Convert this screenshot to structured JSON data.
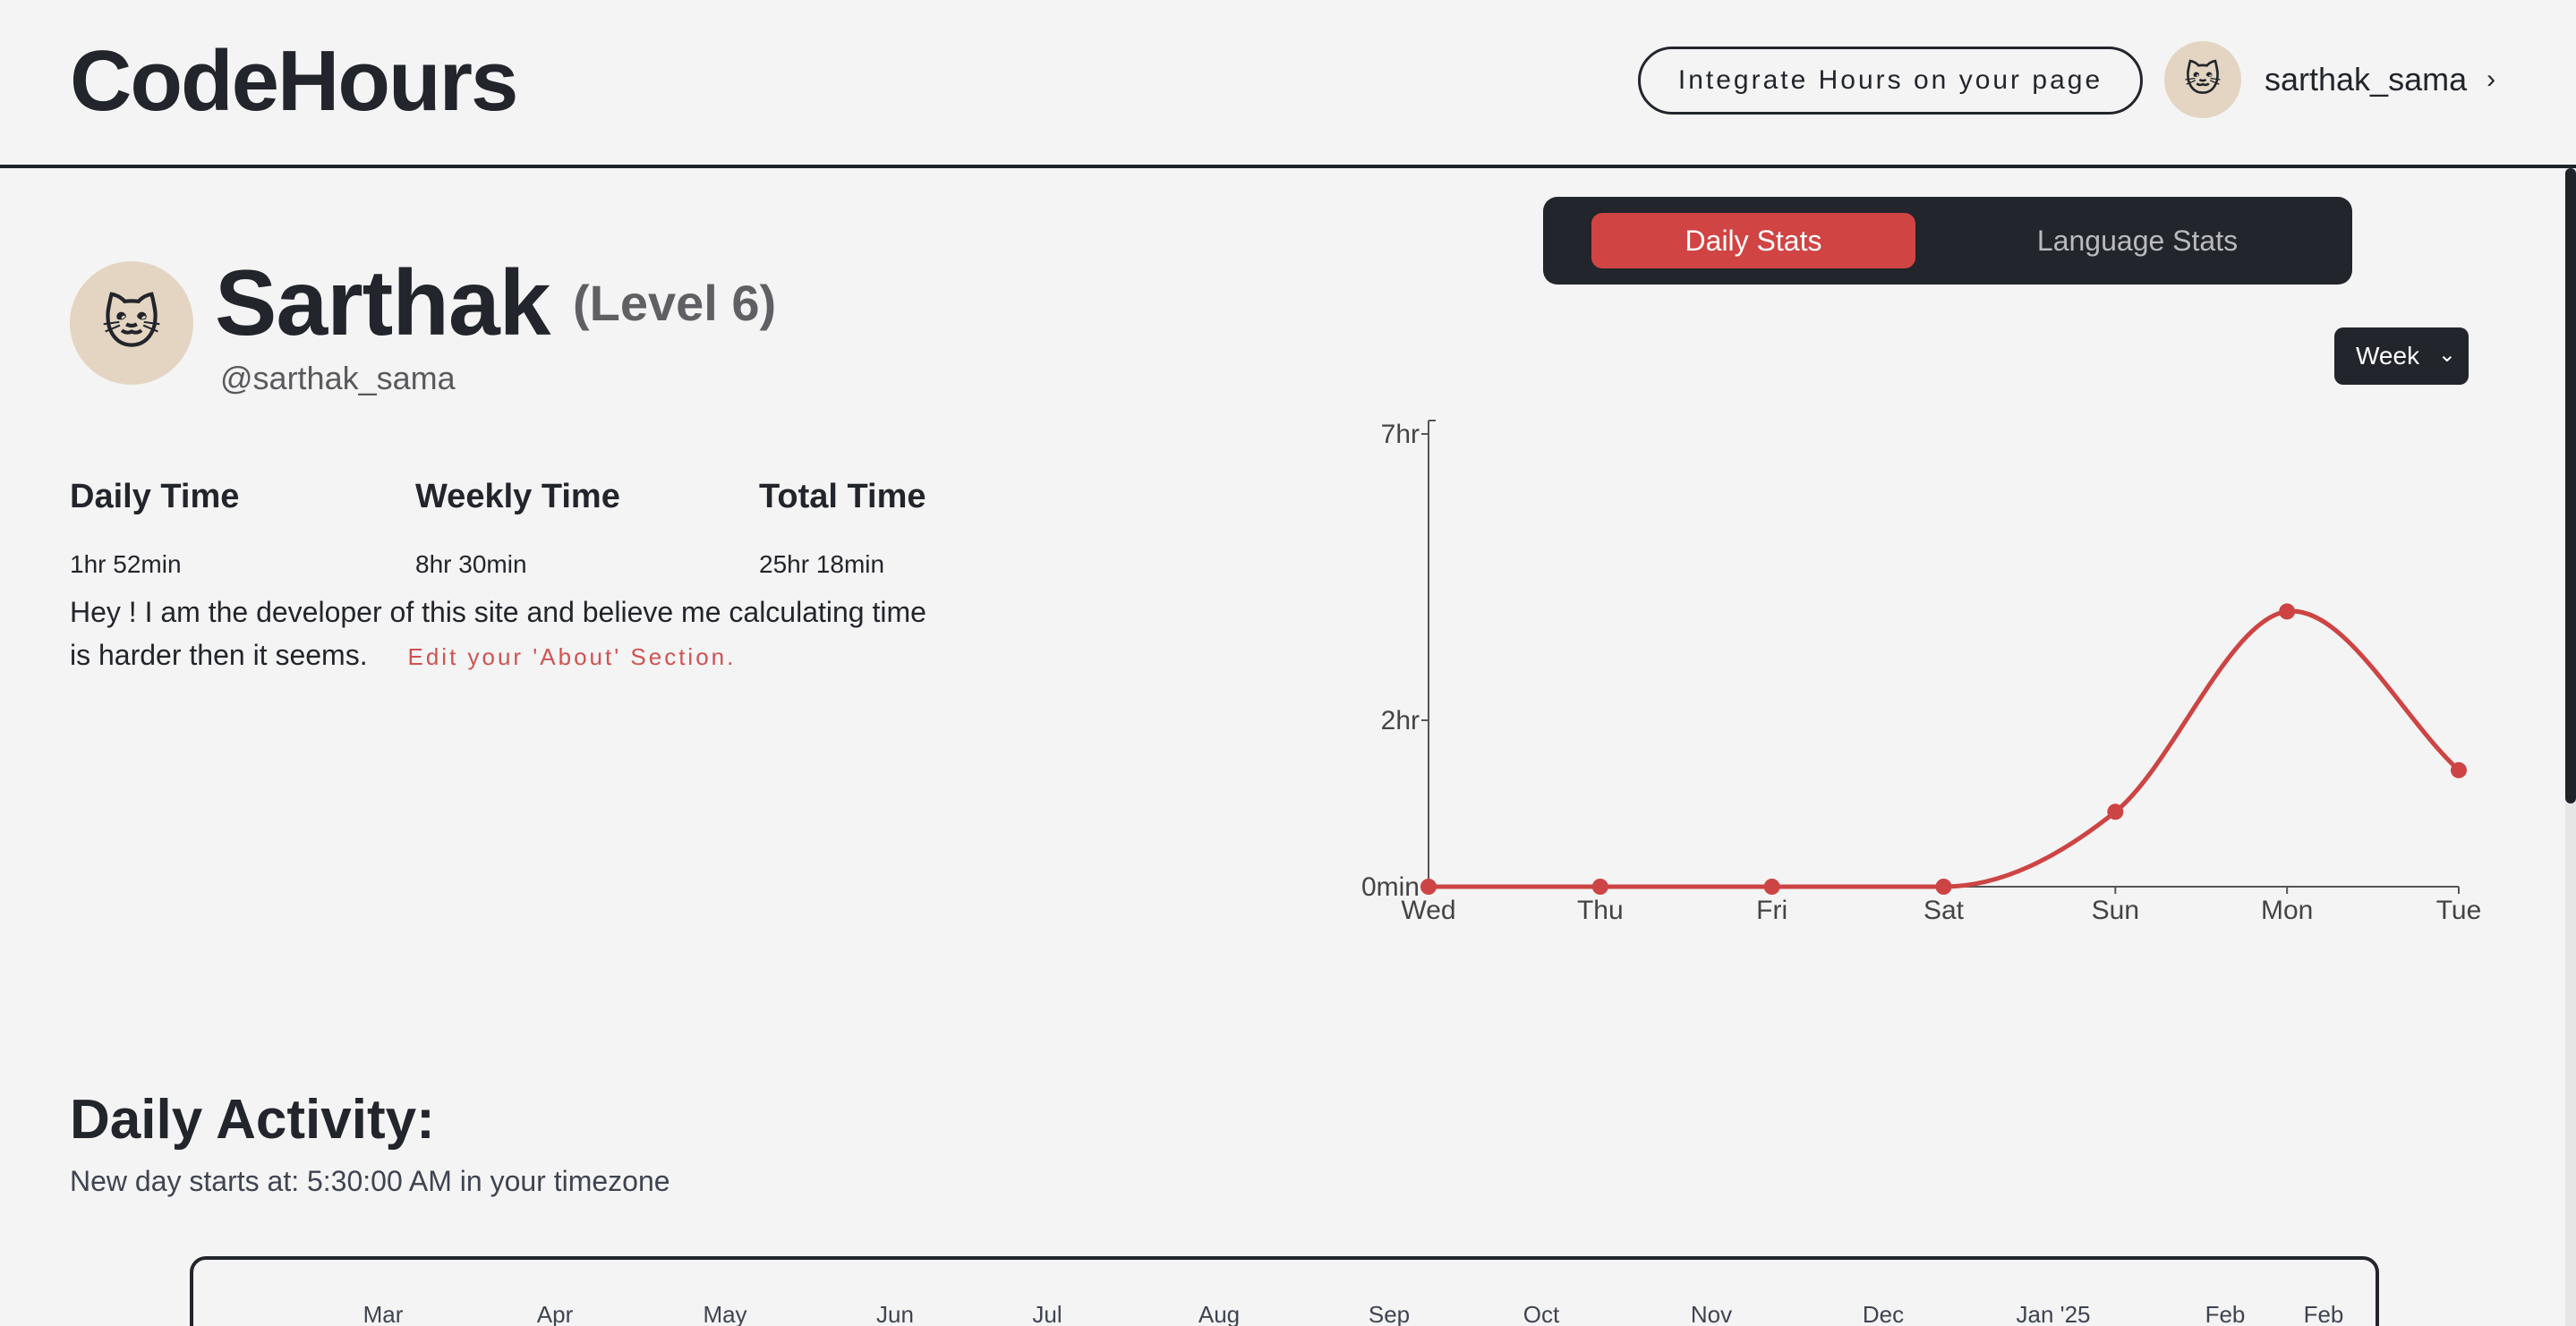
{
  "header": {
    "logo": "CodeHours",
    "integrate_label": "Integrate Hours on your page",
    "username": "sarthak_sama",
    "chevron": "›"
  },
  "profile": {
    "avatar_icon": "🐱",
    "name": "Sarthak",
    "level": "(Level 6)",
    "handle": "@sarthak_sama",
    "stats": [
      {
        "label": "Daily Time",
        "value": "1hr 52min"
      },
      {
        "label": "Weekly Time",
        "value": "8hr 30min"
      },
      {
        "label": "Total Time",
        "value": "25hr 18min"
      }
    ],
    "about": "Hey ! I am the developer of this site and believe me calculating time is harder then it seems.",
    "edit_about": "Edit your 'About' Section."
  },
  "stats_tabs": {
    "daily": "Daily Stats",
    "language": "Language Stats",
    "active": "daily"
  },
  "range_select": {
    "selected": "Week",
    "chevron": "⌄"
  },
  "chart_data": {
    "type": "line",
    "categories": [
      "Wed",
      "Thu",
      "Fri",
      "Sat",
      "Sun",
      "Mon",
      "Tue"
    ],
    "values_hours": [
      0,
      0,
      0,
      0,
      0.9,
      3.9,
      1.4
    ],
    "ytick_labels": [
      "0min",
      "2hr",
      "7hr"
    ],
    "ytick_values": [
      0,
      2,
      7
    ],
    "ylim": [
      0,
      7
    ],
    "color": "#cd4444",
    "grid": false,
    "legend": false
  },
  "activity": {
    "title": "Daily Activity:",
    "subtitle": "New day starts at: 5:30:00 AM in your timezone",
    "months": [
      "Mar",
      "Apr",
      "May",
      "Jun",
      "Jul",
      "Aug",
      "Sep",
      "Oct",
      "Nov",
      "Dec",
      "Jan '25",
      "Feb",
      "Feb"
    ]
  },
  "colors": {
    "accent": "#d04444",
    "dark": "#22252b",
    "background": "#f4f4f4",
    "link": "#d05252"
  }
}
